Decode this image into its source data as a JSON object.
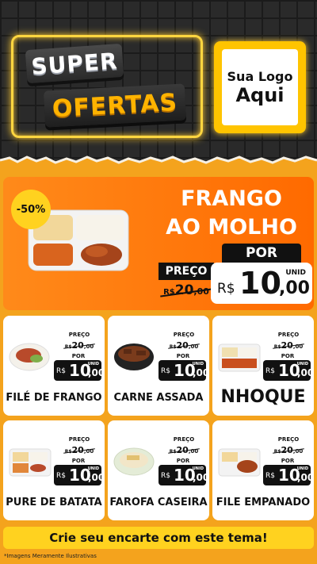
{
  "header": {
    "title_line1": "SUPER",
    "title_line2": "OFERTAS",
    "logo_line1": "Sua Logo",
    "logo_line2": "Aqui"
  },
  "featured": {
    "discount_badge": "-50%",
    "name_line1": "FRANGO",
    "name_line2": "AO MOLHO",
    "por_label": "POR",
    "preco_label": "PREÇO",
    "old_currency": "R$",
    "old_int": "20",
    "old_cents": ",00",
    "unit_label": "UNID",
    "new_currency": "R$",
    "new_int": "10",
    "new_cents": ",00"
  },
  "products": [
    {
      "name": "FILÉ DE FRANGO",
      "preco_label": "PREÇO",
      "old_currency": "R$",
      "old_int": "20",
      "old_cents": ",00",
      "por_label": "POR",
      "currency": "R$",
      "int": "10",
      "cents": ",00",
      "unit_label": "UNID"
    },
    {
      "name": "CARNE ASSADA",
      "preco_label": "PREÇO",
      "old_currency": "R$",
      "old_int": "20",
      "old_cents": ",00",
      "por_label": "POR",
      "currency": "R$",
      "int": "10",
      "cents": ",00",
      "unit_label": "UNID"
    },
    {
      "name": "NHOQUE",
      "preco_label": "PREÇO",
      "old_currency": "R$",
      "old_int": "20",
      "old_cents": ",00",
      "por_label": "POR",
      "currency": "R$",
      "int": "10",
      "cents": ",00",
      "unit_label": "UNID"
    },
    {
      "name": "PURE DE BATATA",
      "preco_label": "PREÇO",
      "old_currency": "R$",
      "old_int": "20",
      "old_cents": ",00",
      "por_label": "POR",
      "currency": "R$",
      "int": "10",
      "cents": ",00",
      "unit_label": "UNID"
    },
    {
      "name": "FAROFA CASEIRA",
      "preco_label": "PREÇO",
      "old_currency": "R$",
      "old_int": "20",
      "old_cents": ",00",
      "por_label": "POR",
      "currency": "R$",
      "int": "10",
      "cents": ",00",
      "unit_label": "UNID"
    },
    {
      "name": "FILE EMPANADO",
      "preco_label": "PREÇO",
      "old_currency": "R$",
      "old_int": "20",
      "old_cents": ",00",
      "por_label": "POR",
      "currency": "R$",
      "int": "10",
      "cents": ",00",
      "unit_label": "UNID"
    }
  ],
  "cta": "Crie seu encarte com este tema!",
  "disclaimer": "*Imagens Meramente Ilustrativas",
  "colors": {
    "accent_orange": "#ff7a0d",
    "background_orange": "#f4a31d",
    "badge_yellow": "#ffd21f",
    "neon_yellow": "#ffd640"
  }
}
